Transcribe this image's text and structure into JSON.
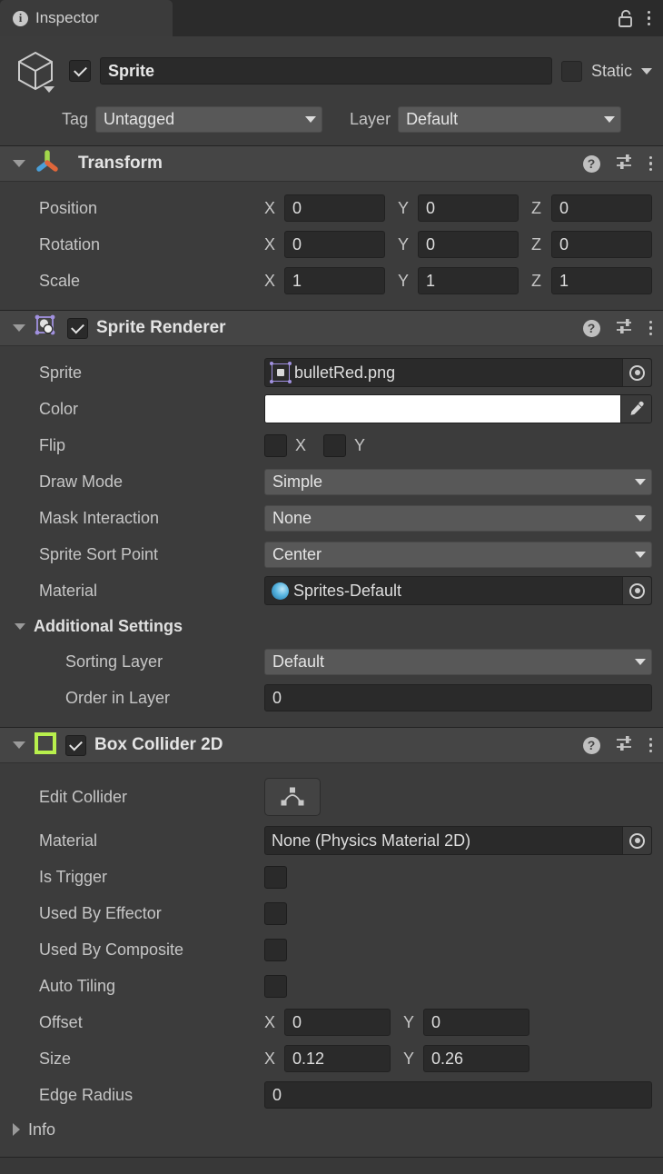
{
  "window": {
    "tab_label": "Inspector",
    "tab_icon": "info-icon",
    "lock_icon": "unlocked-padlock-icon",
    "menu_icon": "kebab-menu-icon"
  },
  "gameobject": {
    "icon": "cube-icon",
    "enabled": true,
    "name": "Sprite",
    "static_label": "Static",
    "static_checked": false,
    "tag_label": "Tag",
    "tag_value": "Untagged",
    "layer_label": "Layer",
    "layer_value": "Default"
  },
  "components": [
    {
      "title": "Transform",
      "icon": "transform-gizmo-icon",
      "has_enable_checkbox": false,
      "expanded": true,
      "help_icon": "help-icon",
      "preset_icon": "preset-sliders-icon",
      "menu_icon": "kebab-menu-icon",
      "rows": [
        {
          "label": "Position",
          "type": "vector3",
          "x": "0",
          "y": "0",
          "z": "0"
        },
        {
          "label": "Rotation",
          "type": "vector3",
          "x": "0",
          "y": "0",
          "z": "0"
        },
        {
          "label": "Scale",
          "type": "vector3",
          "x": "1",
          "y": "1",
          "z": "1"
        }
      ]
    },
    {
      "title": "Sprite Renderer",
      "icon": "sprite-renderer-icon",
      "has_enable_checkbox": true,
      "enabled": true,
      "expanded": true,
      "help_icon": "help-icon",
      "preset_icon": "preset-sliders-icon",
      "menu_icon": "kebab-menu-icon",
      "rows": [
        {
          "label": "Sprite",
          "type": "object",
          "value": "bulletRed.png",
          "chip": "sprite-asset-icon"
        },
        {
          "label": "Color",
          "type": "color",
          "value": "#FFFFFF"
        },
        {
          "label": "Flip",
          "type": "flip",
          "x_label": "X",
          "y_label": "Y",
          "x_checked": false,
          "y_checked": false
        },
        {
          "label": "Draw Mode",
          "type": "dropdown",
          "value": "Simple"
        },
        {
          "label": "Mask Interaction",
          "type": "dropdown",
          "value": "None"
        },
        {
          "label": "Sprite Sort Point",
          "type": "dropdown",
          "value": "Center"
        },
        {
          "label": "Material",
          "type": "object",
          "value": "Sprites-Default",
          "chip": "material-ball-icon"
        }
      ],
      "subsection": {
        "title": "Additional Settings",
        "expanded": true,
        "rows": [
          {
            "label": "Sorting Layer",
            "type": "dropdown",
            "value": "Default"
          },
          {
            "label": "Order in Layer",
            "type": "text",
            "value": "0"
          }
        ]
      }
    },
    {
      "title": "Box Collider 2D",
      "icon": "box-collider-2d-icon",
      "has_enable_checkbox": true,
      "enabled": true,
      "expanded": true,
      "help_icon": "help-icon",
      "preset_icon": "preset-sliders-icon",
      "menu_icon": "kebab-menu-icon",
      "rows": [
        {
          "label": "Edit Collider",
          "type": "button",
          "button_icon": "edit-collider-icon"
        },
        {
          "label": "Material",
          "type": "object",
          "value": "None (Physics Material 2D)"
        },
        {
          "label": "Is Trigger",
          "type": "checkbox",
          "checked": false
        },
        {
          "label": "Used By Effector",
          "type": "checkbox",
          "checked": false
        },
        {
          "label": "Used By Composite",
          "type": "checkbox",
          "checked": false
        },
        {
          "label": "Auto Tiling",
          "type": "checkbox",
          "checked": false
        },
        {
          "label": "Offset",
          "type": "vector2",
          "x": "0",
          "y": "0"
        },
        {
          "label": "Size",
          "type": "vector2",
          "x": "0.12",
          "y": "0.26"
        },
        {
          "label": "Edge Radius",
          "type": "text",
          "value": "0"
        }
      ],
      "info_foldout": {
        "label": "Info",
        "expanded": false
      }
    }
  ],
  "colors": {
    "panel_bg": "#3c3c3c",
    "header_bg": "#454545",
    "tabbar_bg": "#2b2b2b",
    "field_bg": "#2a2a2a",
    "dropdown_bg": "#585858",
    "accent_purple": "#a191e0",
    "accent_green": "#b8f04d",
    "text": "#c6c6c6"
  }
}
